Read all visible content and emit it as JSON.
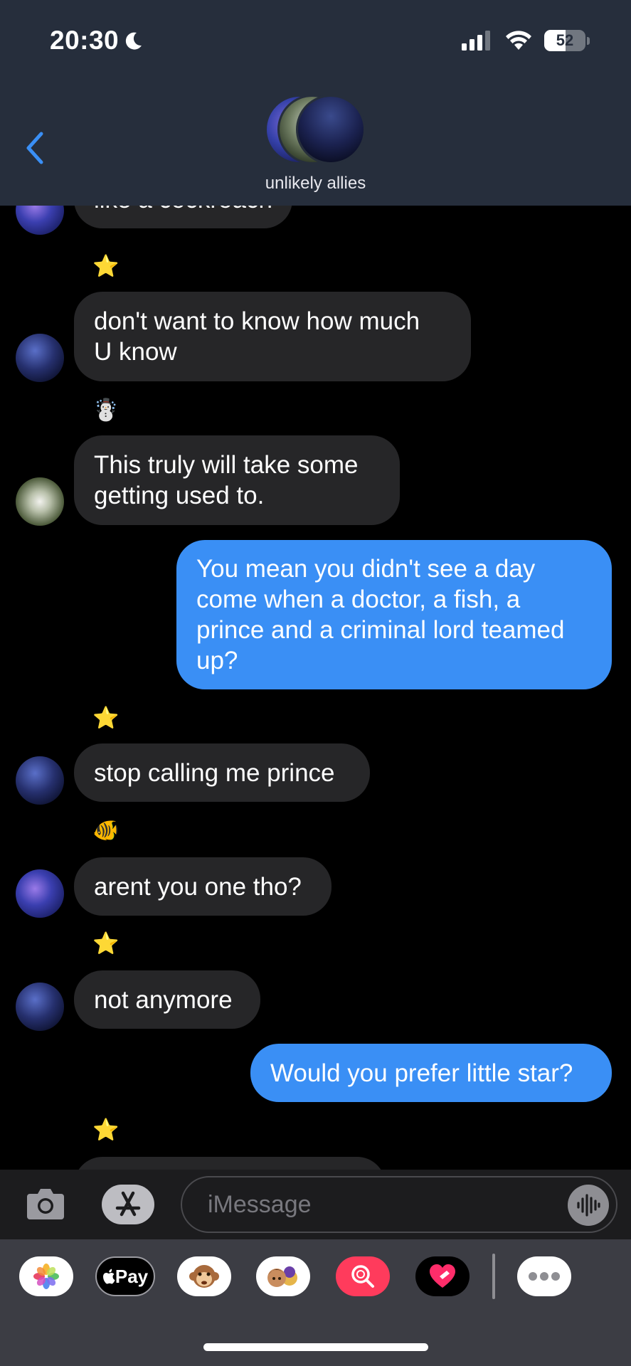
{
  "status_bar": {
    "time": "20:30",
    "battery": "52",
    "signal_icon": "cellular-signal-icon",
    "wifi_icon": "wifi-icon",
    "focus_icon": "moon-icon"
  },
  "header": {
    "group_name": "unlikely allies",
    "back_icon": "chevron-left-icon"
  },
  "messages": [
    {
      "dir": "in",
      "text": "like a cockroach",
      "avatar": "fish"
    },
    {
      "dir": "in",
      "sender_emoji": "⭐",
      "text": "don't want to know how much\nU know",
      "avatar": "sky"
    },
    {
      "dir": "in",
      "sender_emoji": "☃️",
      "text": "This truly will take some\ngetting used to.",
      "avatar": "flower"
    },
    {
      "dir": "out",
      "text": "You mean you didn't see a day\ncome when a doctor, a fish, a\nprince and a criminal lord teamed\nup?"
    },
    {
      "dir": "in",
      "sender_emoji": "⭐",
      "text": "stop calling me prince",
      "avatar": "sky"
    },
    {
      "dir": "in",
      "sender_emoji": "🐠",
      "text": "arent you one tho?",
      "avatar": "fish"
    },
    {
      "dir": "in",
      "sender_emoji": "⭐",
      "text": "not anymore",
      "avatar": "sky"
    },
    {
      "dir": "out",
      "text": "Would you prefer little star?"
    },
    {
      "dir": "in",
      "sender_emoji": "⭐",
      "text": "",
      "avatar": "sky"
    }
  ],
  "input": {
    "placeholder": "iMessage",
    "camera_icon": "camera-icon",
    "apps_icon": "app-store-icon",
    "voice_icon": "waveform-icon"
  },
  "drawer": {
    "apps": [
      "photos-icon",
      "apple-pay-icon",
      "animoji-icon",
      "memoji-icon",
      "image-search-icon",
      "heart-sticker-icon",
      "more-icon"
    ],
    "pay_label": "Pay"
  },
  "colors": {
    "incoming_bubble": "#262628",
    "outgoing_bubble": "#3a8ff5",
    "header_bg": "#262e3c",
    "accent": "#3a8ff5"
  }
}
